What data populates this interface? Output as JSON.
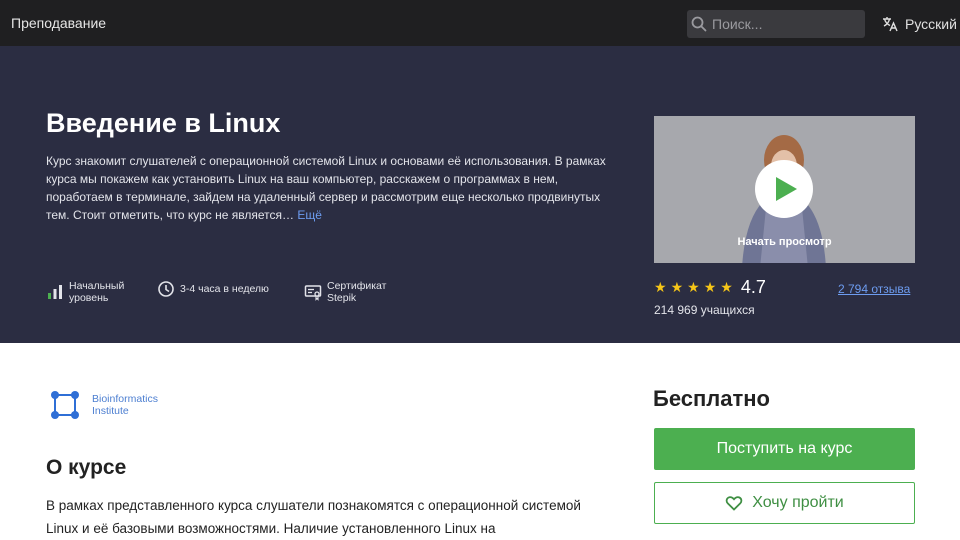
{
  "topbar": {
    "teaching_link": "Преподавание",
    "search_placeholder": "Поиск...",
    "language": "Русский"
  },
  "course": {
    "title": "Введение в Linux",
    "description": "Курс знакомит слушателей с операционной системой Linux и основами её использования. В рамках курса мы покажем как установить Linux на ваш компьютер, расскажем о программах в нем, поработаем в терминале, зайдем на удаленный сервер и рассмотрим еще несколько продвинутых тем. Стоит отметить, что курс не является…",
    "more_link": "Ещё",
    "meta": {
      "level": "Начальный уровень",
      "workload": "3-4 часа в неделю",
      "certificate": "Сертификат Stepik"
    }
  },
  "video": {
    "caption": "Начать просмотр"
  },
  "rating": {
    "stars": 5,
    "value": "4.7",
    "reviews": "2 794 отзыва",
    "students": "214 969 учащихся"
  },
  "organization": {
    "name": "Bioinformatics Institute"
  },
  "about": {
    "title": "О курсе",
    "text": "В рамках представленного курса слушатели познакомятся с операционной системой Linux и её базовыми возможностями. Наличие установленного Linux на"
  },
  "sidebar": {
    "price": "Бесплатно",
    "enroll_label": "Поступить на курс",
    "wishlist_label": "Хочу пройти"
  },
  "colors": {
    "topbar_bg": "#1f1f21",
    "hero_bg": "#2b2d42",
    "accent_green": "#4caf50",
    "link_blue": "#6d9cf0",
    "star_yellow": "#f5c518"
  }
}
